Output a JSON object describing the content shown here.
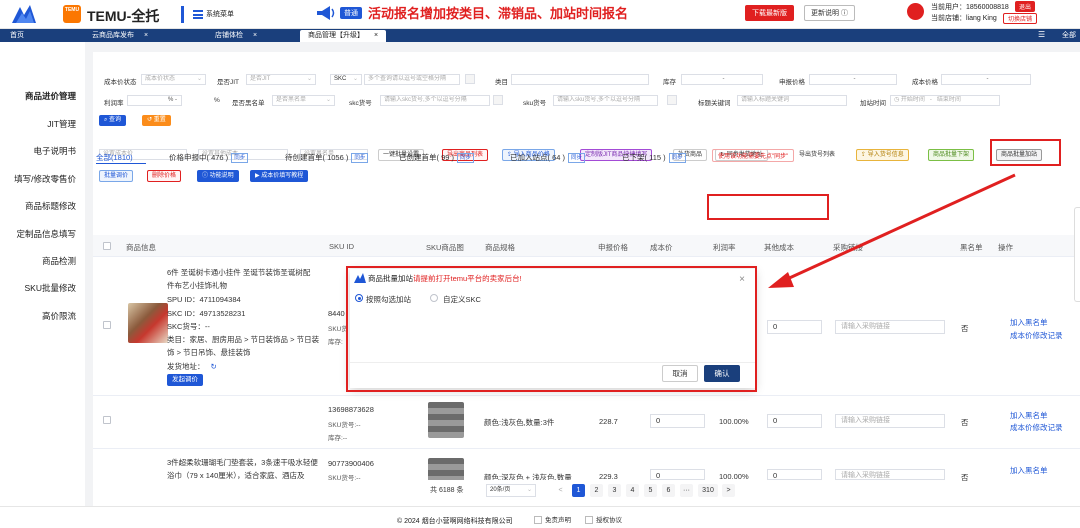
{
  "header": {
    "brand": "TEMU-全托",
    "temu_badge": "TEMU",
    "menu_label": "系统菜单",
    "badge": "普通",
    "notice": "活动报名增加按类目、滞销品、加站时间报名",
    "btn_latest": "下载最新版",
    "btn_changelog": "更新说明 ⓘ",
    "user_label": "当前用户：18560008818",
    "store_label": "当前店铺：liang King",
    "btn_logout": "退出",
    "btn_switch": "切换店铺"
  },
  "tabs": [
    {
      "label": "首页"
    },
    {
      "label": "云商品库发布",
      "close": "×"
    },
    {
      "label": "店铺体检",
      "close": "×"
    },
    {
      "label": "商品管理【升级】",
      "close": "×"
    }
  ],
  "tab_all": "全部",
  "sidebar": {
    "items": [
      {
        "label": "商品进价管理"
      },
      {
        "label": "JIT管理"
      },
      {
        "label": "电子说明书"
      },
      {
        "label": "填写/修改零售价"
      },
      {
        "label": "商品标题修改"
      },
      {
        "label": "定制品信息填写"
      },
      {
        "label": "商品检测"
      },
      {
        "label": "SKU批量修改"
      },
      {
        "label": "高价限流"
      }
    ]
  },
  "filters": {
    "cost_status_label": "成本价状态",
    "cost_status_ph": "成本价状态",
    "jit_label": "是否JIT",
    "jit_ph": "是否JIT",
    "skc_select": "SKC",
    "skc_ph": "多个查询请以逗号或空格分隔",
    "category_label": "类目",
    "stock_label": "库存",
    "stock_dash": "-",
    "supply_label": "申报价格",
    "supply_dash": "-",
    "cost_label": "成本价格",
    "cost_dash": "-",
    "profit_label": "利润率",
    "profit_pct1": "% -",
    "profit_pct2": "%",
    "blacklist_label": "是否黑名单",
    "blacklist_ph": "是否黑名单",
    "skc_code_label": "skc货号",
    "skc_code_ph": "请输入skc货号,多个以逗号分隔",
    "sku_code_label": "sku货号",
    "sku_code_ph": "请输入sku货号,多个以逗号分隔",
    "title_kw_label": "标题关键词",
    "title_kw_ph": "请输入标题关键词",
    "join_time_label": "加站时间",
    "join_start_ph": "开始时间",
    "join_sep": "-",
    "join_end_ph": "结束时间",
    "btn_query": "查询",
    "btn_reset": "重置"
  },
  "actions": {
    "cost_ph": "设置成本价",
    "other_cost_ph": "设置其他成本",
    "set_blacklist_ph": "设置黑名单",
    "btn_batch_set": "一键批量设置",
    "btn_export": "导出商品列表",
    "btn_import_price": "导入商品价格",
    "btn_custom_jit": "定制版JIT商品快捷填写",
    "btn_add_goods": "补货商品",
    "btn_sync_addr": "同步发货地址",
    "btn_export_code": "导出货号列表",
    "btn_import_code": "导入货号信息",
    "btn_batch_off": "商品批量下架",
    "btn_batch_join": "商品批量加站",
    "btn_batch_price": "批量调价",
    "btn_delete_price": "删除价格",
    "btn_func_desc": "功能说明",
    "btn_cost_video": "成本价填写教程"
  },
  "status_tabs": [
    {
      "label": "全部(1810)"
    },
    {
      "label": "价格申报中( 476 )",
      "sync": "同步"
    },
    {
      "label": "待创建首单( 1056 )",
      "sync": "同步"
    },
    {
      "label": "已创建首单( 99 )",
      "sync": "同步"
    },
    {
      "label": "已加入站点( 64 )",
      "sync": "同步"
    },
    {
      "label": "已下架( 115 )",
      "sync": "同步"
    }
  ],
  "hint_pill": "使用该功能需要先点\"同步\"",
  "columns": [
    "商品信息",
    "SKU ID",
    "SKU商品图",
    "商品规格",
    "申报价格",
    "成本价",
    "利润率",
    "其他成本",
    "采购链接",
    "黑名单",
    "操作"
  ],
  "rows": [
    {
      "title1": "6件 圣诞树卡通小挂件 圣诞节装饰圣诞树配",
      "title2": "件布艺小挂饰礼物",
      "spu": "SPU ID：4711094384",
      "skc": "SKC ID：49713528231",
      "skc_code": "SKC货号：--",
      "category1": "类目：家居、厨房用品 > 节日装饰品 > 节日装",
      "category2": "饰 > 节日吊饰、悬挂装饰",
      "ship_addr": "发货地址：",
      "ship_icon": "↻",
      "btn_adjust": "发起调价",
      "sku_id": "8440",
      "sku_code": "SKU货",
      "stock": "库存:",
      "other_cost": "0",
      "link_ph": "请输入采购链接",
      "blacklist": "否",
      "op1": "加入黑名单",
      "op2": "成本价修改记录"
    },
    {
      "sku_id": "13698873628",
      "sku_code": "SKU货号:--",
      "stock": "库存:--",
      "spec": "颜色:浅灰色,数量:3件",
      "price": "228.7",
      "cost": "0",
      "profit": "100.00%",
      "other_cost": "0",
      "link_ph": "请输入采购链接",
      "blacklist": "否",
      "op1": "加入黑名单",
      "op2": "成本价修改记录"
    },
    {
      "title1": "3件超柔软珊瑚毛门垫套装，3条速干吸水轻便",
      "title2": "浴巾（79 x 140厘米），适合家庭、酒店及",
      "sku_id": "90773900406",
      "sku_code": "SKU货号:--",
      "spec": "颜色:深灰色 + 浅灰色,数量",
      "price": "229.3",
      "cost": "0",
      "profit": "100.00%",
      "other_cost": "0",
      "link_ph": "请输入采购链接",
      "blacklist": "否",
      "op1": "加入黑名单"
    }
  ],
  "pagination": {
    "total": "共 6188 条",
    "page_size": "20条/页",
    "prev": "<",
    "pages": [
      "1",
      "2",
      "3",
      "4",
      "5",
      "6"
    ],
    "ellipsis": "···",
    "last": "310",
    "next": ">"
  },
  "modal": {
    "title": "商品批量加站",
    "warning": "请提前打开temu平台的卖家后台!",
    "close": "×",
    "opt1": "按照勾选加站",
    "opt2": "自定义SKC",
    "btn_cancel": "取消",
    "btn_confirm": "确认"
  },
  "footer": {
    "copyright": "© 2024 烟台小营啊网络科技有限公司",
    "disclaimer": "免责声明",
    "license": "授权协议"
  },
  "colors": {
    "primary": "#1f57d6",
    "accent": "#e02020",
    "navy": "#1a3f7c",
    "orange": "#fb7701"
  }
}
